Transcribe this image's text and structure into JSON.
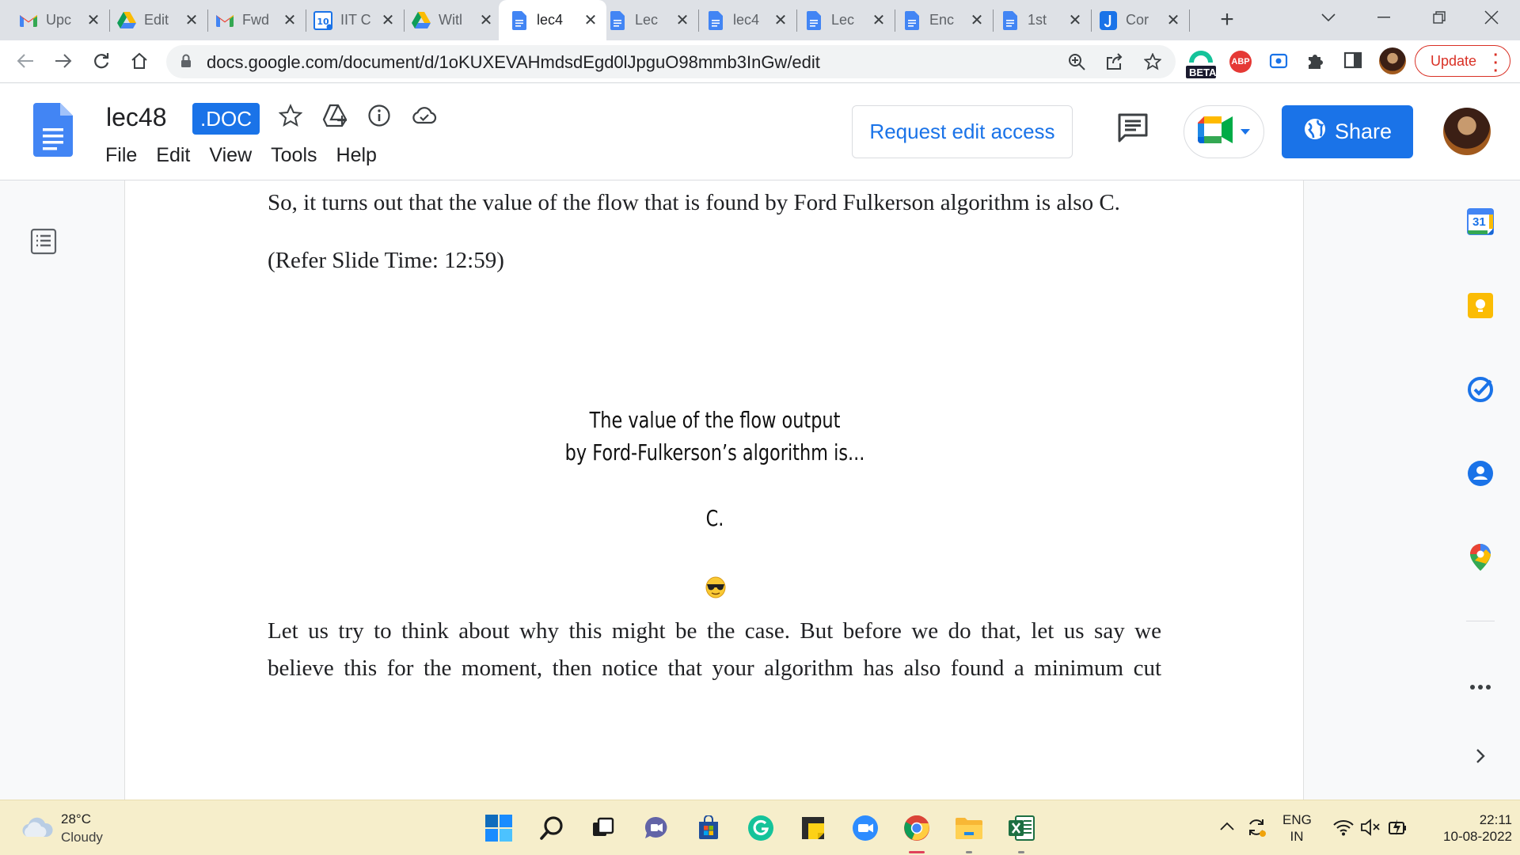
{
  "browser": {
    "tabs": [
      {
        "title": "Upc",
        "icon": "gmail-icon",
        "active": false
      },
      {
        "title": "Edit",
        "icon": "drive-icon",
        "active": false
      },
      {
        "title": "Fwd",
        "icon": "gmail-icon",
        "active": false
      },
      {
        "title": "IIT C",
        "icon": "calendar-10-icon",
        "active": false
      },
      {
        "title": "Witl",
        "icon": "drive-icon",
        "active": false
      },
      {
        "title": "lec4",
        "icon": "docs-icon",
        "active": true
      },
      {
        "title": "Lec",
        "icon": "docs-icon",
        "active": false
      },
      {
        "title": "lec4",
        "icon": "docs-icon",
        "active": false
      },
      {
        "title": "Lec",
        "icon": "docs-icon",
        "active": false
      },
      {
        "title": "Enc",
        "icon": "docs-icon",
        "active": false
      },
      {
        "title": "1st",
        "icon": "docs-icon",
        "active": false
      },
      {
        "title": "Cor",
        "icon": "j-icon",
        "active": false
      }
    ],
    "url": "docs.google.com/document/d/1oKUXEVAHmdsdEgd0lJpguO98mmb3InGw/edit",
    "beta_label": "BETA",
    "abp_label": "ABP",
    "update_label": "Update"
  },
  "doc": {
    "title": "lec48",
    "badge": ".DOC",
    "menu": [
      "File",
      "Edit",
      "View",
      "Tools",
      "Help"
    ],
    "request_edit_label": "Request edit access",
    "share_label": "Share",
    "paragraphs": {
      "p1": "So, it turns out that the value of the flow that is found by Ford Fulkerson algorithm is also C.",
      "p2": "(Refer Slide Time: 12:59)",
      "p3": "Let us try to think about why this might be the case. But before we do that, let us say we",
      "p4": "believe this for the moment, then notice that your algorithm has also found a minimum cut"
    },
    "slide": {
      "line1": "The value of the flow output",
      "line2": "by Ford-Fulkerson’s algorithm is...",
      "line3": "C.",
      "emoji": "sunglasses-emoji"
    }
  },
  "side_panel": {
    "calendar_day": "31",
    "apps": [
      "calendar-icon",
      "keep-icon",
      "tasks-icon",
      "contacts-icon",
      "maps-icon"
    ]
  },
  "taskbar": {
    "weather_temp": "28°C",
    "weather_desc": "Cloudy",
    "lang_line1": "ENG",
    "lang_line2": "IN",
    "time": "22:11",
    "date": "10-08-2022",
    "apps": [
      "windows-start-icon",
      "search-icon",
      "task-view-icon",
      "teams-chat-icon",
      "store-icon",
      "grammarly-icon",
      "sticky-notes-icon",
      "zoom-icon",
      "chrome-icon",
      "file-explorer-icon",
      "excel-icon"
    ]
  }
}
